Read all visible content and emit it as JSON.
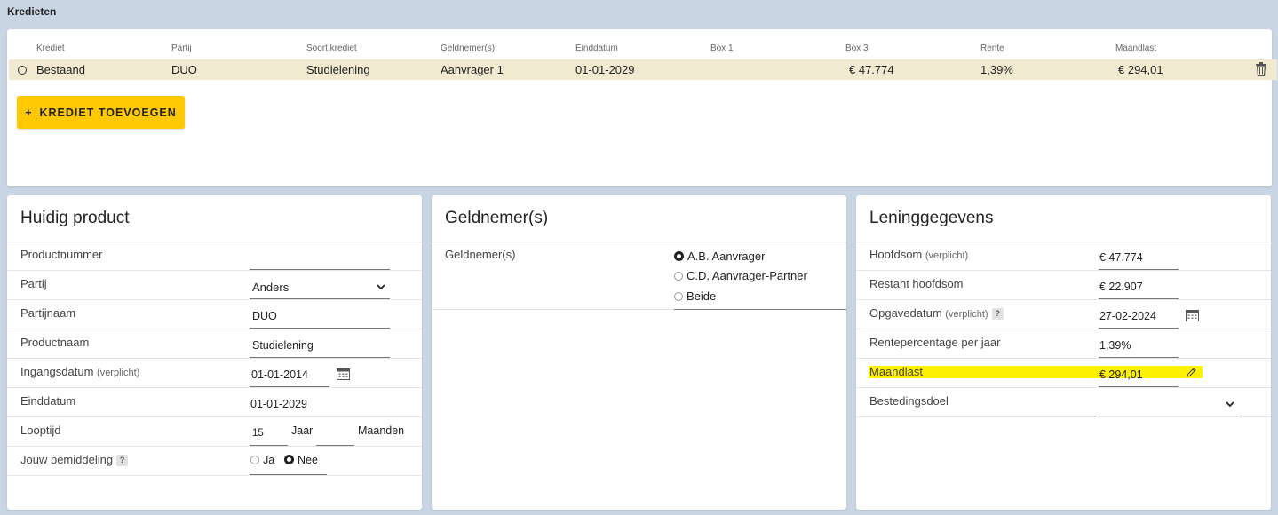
{
  "section": {
    "title": "Kredieten"
  },
  "credits": {
    "columns": [
      "Krediet",
      "Partij",
      "Soort krediet",
      "Geldnemer(s)",
      "Einddatum",
      "Box 1",
      "Box 3",
      "Rente",
      "Maandlast"
    ],
    "rows": [
      {
        "krediet": "Bestaand",
        "partij": "DUO",
        "soort": "Studielening",
        "geldnemer": "Aanvrager 1",
        "einddatum": "01-01-2029",
        "box1": "",
        "box3": "€ 47.774",
        "rente": "1,39%",
        "maandlast": "€ 294,01"
      }
    ],
    "add_button": {
      "icon": "+",
      "label": "KREDIET TOEVOEGEN"
    }
  },
  "huidig": {
    "title": "Huidig product",
    "productnummer": {
      "label": "Productnummer",
      "value": ""
    },
    "partij": {
      "label": "Partij",
      "value": "Anders"
    },
    "partijnaam": {
      "label": "Partijnaam",
      "value": "DUO"
    },
    "productnaam": {
      "label": "Productnaam",
      "value": "Studielening"
    },
    "ingangsdatum": {
      "label": "Ingangsdatum",
      "hint": "(verplicht)",
      "value": "01-01-2014"
    },
    "einddatum": {
      "label": "Einddatum",
      "value": "01-01-2029"
    },
    "looptijd": {
      "label": "Looptijd",
      "jaar_value": "15",
      "jaar_label": "Jaar",
      "maanden_value": "",
      "maanden_label": "Maanden"
    },
    "bemiddeling": {
      "label": "Jouw bemiddeling",
      "help": "?",
      "options": [
        "Ja",
        "Nee"
      ],
      "selected": "Nee"
    }
  },
  "geldnemer": {
    "title": "Geldnemer(s)",
    "label": "Geldnemer(s)",
    "options": [
      "A.B. Aanvrager",
      "C.D. Aanvrager-Partner",
      "Beide"
    ],
    "selected": "A.B. Aanvrager"
  },
  "lening": {
    "title": "Leninggegevens",
    "hoofdsom": {
      "label": "Hoofdsom",
      "hint": "(verplicht)",
      "value": "€ 47.774"
    },
    "restant": {
      "label": "Restant hoofdsom",
      "value": "€ 22.907"
    },
    "opgavedatum": {
      "label": "Opgavedatum",
      "hint": "(verplicht)",
      "help": "?",
      "value": "27-02-2024"
    },
    "rente": {
      "label": "Rentepercentage per jaar",
      "value": "1,39%"
    },
    "maandlast": {
      "label": "Maandlast",
      "value": "€ 294,01"
    },
    "bestedingsdoel": {
      "label": "Bestedingsdoel",
      "value": ""
    }
  },
  "colors": {
    "accent": "#ffc800",
    "highlight": "#fff200",
    "row_selected": "#f1e9d0",
    "background": "#c9d5e3"
  }
}
